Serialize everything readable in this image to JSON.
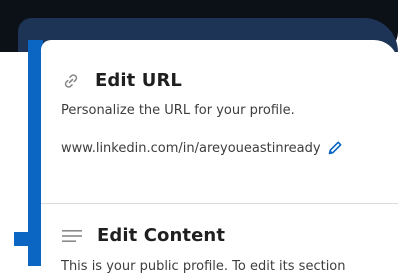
{
  "edit_url": {
    "title": "Edit URL",
    "description": "Personalize the URL for your profile.",
    "url": "www.linkedin.com/in/areyoueastinready"
  },
  "edit_content": {
    "title": "Edit Content",
    "description_partial": "This is your public profile. To edit its section"
  },
  "icons": {
    "link": "link-icon",
    "pencil": "pencil-icon",
    "lines": "lines-icon"
  },
  "colors": {
    "accent_blue": "#0a66c2",
    "dark_header": "#0b1117",
    "header_inner": "#1d3457"
  }
}
